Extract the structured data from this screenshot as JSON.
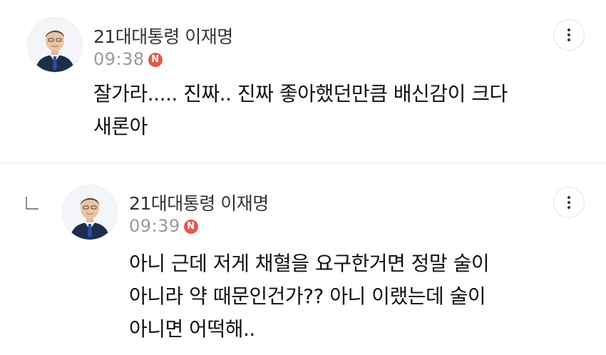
{
  "comments": [
    {
      "author": "21대대통령 이재명",
      "time": "09:38",
      "badge": "N",
      "lines": [
        "잘가라..... 진짜.. 진짜 좋아했던만큼 배신감이 크다",
        "새론아"
      ],
      "is_reply": false
    },
    {
      "author": "21대대통령 이재명",
      "time": "09:39",
      "badge": "N",
      "lines": [
        "아니 근데 저게 채혈을 요구한거면 정말 술이",
        "아니라 약 때문인건가?? 아니 이랬는데 술이",
        "아니면 어떡해.."
      ],
      "is_reply": true
    }
  ],
  "colors": {
    "badge": "#e5574a",
    "time": "#9a9a9a",
    "author": "#333333",
    "divider": "#e6e6e6"
  },
  "icons": {
    "more": "more-vertical-icon",
    "reply": "reply-indent-icon",
    "new": "new-badge-icon"
  }
}
